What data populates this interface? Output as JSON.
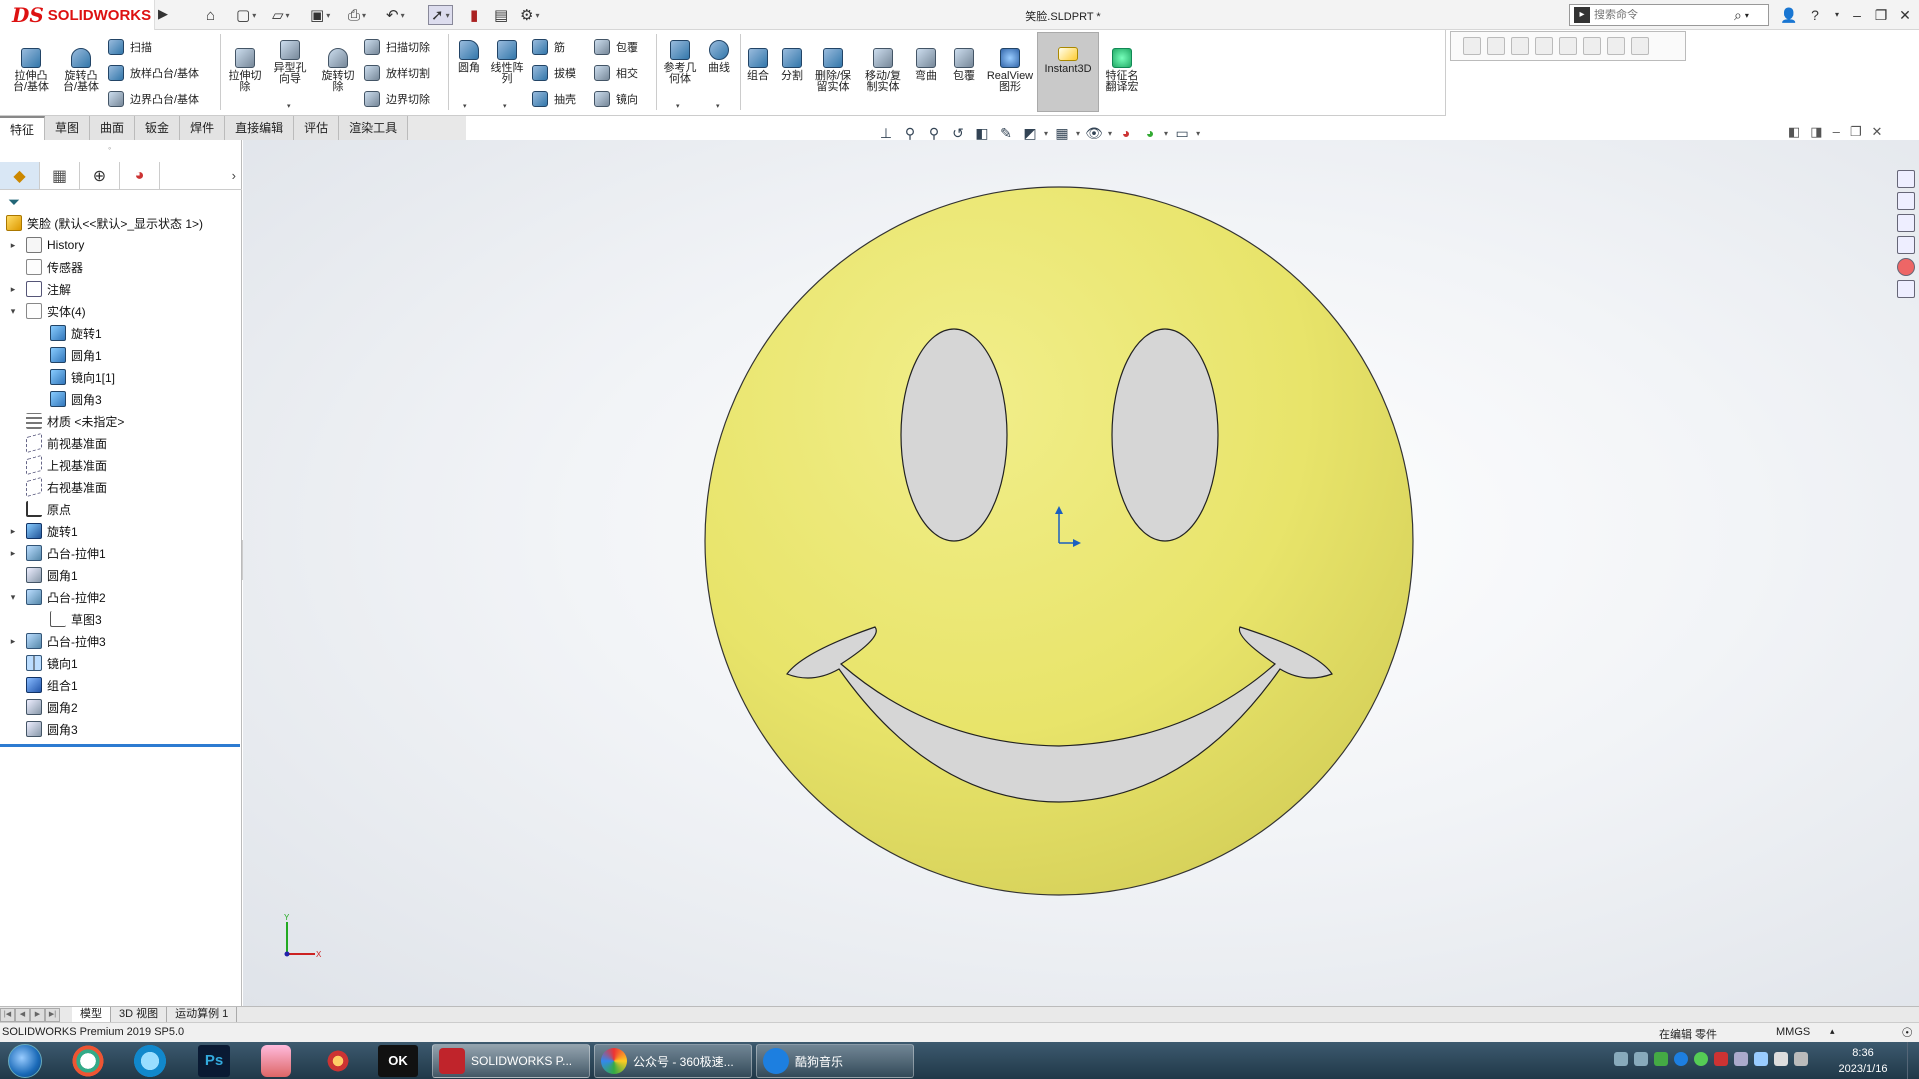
{
  "window": {
    "logo_ds": "DS",
    "logo_text": "SOLIDWORKS",
    "doc_title": "笑脸.SLDPRT *",
    "search_placeholder": "搜索命令",
    "help_label": "?"
  },
  "command_manager": {
    "big_buttons": [
      {
        "id": "extruded-boss",
        "label": "拉伸凸\n台/基体",
        "icon": "extrude-boss-icon"
      },
      {
        "id": "revolved-boss",
        "label": "旋转凸\n台/基体",
        "icon": "revolve-boss-icon"
      },
      {
        "id": "extruded-cut",
        "label": "拉伸切\n除",
        "icon": "extrude-cut-icon"
      },
      {
        "id": "hole-wizard",
        "label": "异型孔\n向导",
        "icon": "hole-wizard-icon"
      },
      {
        "id": "revolved-cut",
        "label": "旋转切\n除",
        "icon": "revolve-cut-icon"
      },
      {
        "id": "fillet",
        "label": "圆角",
        "icon": "fillet-icon"
      },
      {
        "id": "linear-pattern",
        "label": "线性阵\n列",
        "icon": "linear-pattern-icon"
      },
      {
        "id": "reference-geometry",
        "label": "参考几\n何体",
        "icon": "reference-geometry-icon"
      },
      {
        "id": "curves",
        "label": "曲线",
        "icon": "curves-icon"
      },
      {
        "id": "combine",
        "label": "组合",
        "icon": "combine-icon"
      },
      {
        "id": "split",
        "label": "分割",
        "icon": "split-icon"
      },
      {
        "id": "delete-keep-body",
        "label": "删除/保\n留实体",
        "icon": "delete-body-icon"
      },
      {
        "id": "move-copy-body",
        "label": "移动/复\n制实体",
        "icon": "move-copy-icon"
      },
      {
        "id": "flex",
        "label": "弯曲",
        "icon": "flex-icon"
      },
      {
        "id": "wrap",
        "label": "包覆",
        "icon": "wrap-icon"
      },
      {
        "id": "realview",
        "label": "RealView\n图形",
        "icon": "realview-icon"
      },
      {
        "id": "instant3d",
        "label": "Instant3D",
        "icon": "instant3d-icon"
      },
      {
        "id": "feature-translate",
        "label": "特征名\n翻译宏",
        "icon": "macro-icon"
      }
    ],
    "small_buttons": [
      {
        "id": "swept-boss",
        "label": "扫描",
        "icon": "sweep-icon"
      },
      {
        "id": "lofted-boss",
        "label": "放样凸台/基体",
        "icon": "loft-icon"
      },
      {
        "id": "boundary-boss",
        "label": "边界凸台/基体",
        "icon": "boundary-icon"
      },
      {
        "id": "swept-cut",
        "label": "扫描切除",
        "icon": "sweep-cut-icon"
      },
      {
        "id": "lofted-cut",
        "label": "放样切割",
        "icon": "loft-cut-icon"
      },
      {
        "id": "boundary-cut",
        "label": "边界切除",
        "icon": "boundary-cut-icon"
      },
      {
        "id": "rib",
        "label": "筋",
        "icon": "rib-icon"
      },
      {
        "id": "draft",
        "label": "拔模",
        "icon": "draft-icon"
      },
      {
        "id": "shell",
        "label": "抽壳",
        "icon": "shell-icon"
      },
      {
        "id": "wrap-small",
        "label": "包覆",
        "icon": "wrap-small-icon"
      },
      {
        "id": "intersect",
        "label": "相交",
        "icon": "intersect-icon"
      },
      {
        "id": "mirror",
        "label": "镜向",
        "icon": "mirror-icon"
      }
    ]
  },
  "tabs": [
    {
      "label": "特征",
      "active": true
    },
    {
      "label": "草图",
      "active": false
    },
    {
      "label": "曲面",
      "active": false
    },
    {
      "label": "钣金",
      "active": false
    },
    {
      "label": "焊件",
      "active": false
    },
    {
      "label": "直接编辑",
      "active": false
    },
    {
      "label": "评估",
      "active": false
    },
    {
      "label": "渲染工具",
      "active": false
    }
  ],
  "feature_tree": {
    "root": "笑脸 (默认<<默认>_显示状态 1>)",
    "nodes": [
      {
        "label": "History",
        "icon": "history-icon",
        "cls": "ni-hist",
        "indent": 0,
        "expander": "▸"
      },
      {
        "label": "传感器",
        "icon": "sensor-icon",
        "cls": "ni-sens",
        "indent": 0,
        "expander": ""
      },
      {
        "label": "注解",
        "icon": "annotation-icon",
        "cls": "ni-ann",
        "indent": 0,
        "expander": "▸"
      },
      {
        "label": "实体(4)",
        "icon": "solid-bodies-icon",
        "cls": "ni-sens",
        "indent": 0,
        "expander": "▾"
      },
      {
        "label": "旋转1",
        "icon": "body-icon",
        "cls": "ni-body",
        "indent": 1,
        "expander": ""
      },
      {
        "label": "圆角1",
        "icon": "body-icon",
        "cls": "ni-body",
        "indent": 1,
        "expander": ""
      },
      {
        "label": "镜向1[1]",
        "icon": "body-icon",
        "cls": "ni-body",
        "indent": 1,
        "expander": ""
      },
      {
        "label": "圆角3",
        "icon": "body-icon",
        "cls": "ni-body",
        "indent": 1,
        "expander": ""
      },
      {
        "label": "材质 <未指定>",
        "icon": "material-icon",
        "cls": "ni-mat",
        "indent": 0,
        "expander": ""
      },
      {
        "label": "前视基准面",
        "icon": "plane-icon",
        "cls": "ni-plane",
        "indent": 0,
        "expander": ""
      },
      {
        "label": "上视基准面",
        "icon": "plane-icon",
        "cls": "ni-plane",
        "indent": 0,
        "expander": ""
      },
      {
        "label": "右视基准面",
        "icon": "plane-icon",
        "cls": "ni-plane",
        "indent": 0,
        "expander": ""
      },
      {
        "label": "原点",
        "icon": "origin-icon",
        "cls": "ni-orig",
        "indent": 0,
        "expander": ""
      },
      {
        "label": "旋转1",
        "icon": "revolve-feature-icon",
        "cls": "ni-rev",
        "indent": 0,
        "expander": "▸"
      },
      {
        "label": "凸台-拉伸1",
        "icon": "extrude-feature-icon",
        "cls": "ni-ext",
        "indent": 0,
        "expander": "▸"
      },
      {
        "label": "圆角1",
        "icon": "fillet-feature-icon",
        "cls": "ni-fil",
        "indent": 0,
        "expander": ""
      },
      {
        "label": "凸台-拉伸2",
        "icon": "extrude-feature-icon",
        "cls": "ni-ext",
        "indent": 0,
        "expander": "▾"
      },
      {
        "label": "草图3",
        "icon": "sketch-icon",
        "cls": "ni-sk",
        "indent": 1,
        "expander": ""
      },
      {
        "label": "凸台-拉伸3",
        "icon": "extrude-feature-icon",
        "cls": "ni-ext",
        "indent": 0,
        "expander": "▸"
      },
      {
        "label": "镜向1",
        "icon": "mirror-feature-icon",
        "cls": "ni-mir",
        "indent": 0,
        "expander": ""
      },
      {
        "label": "组合1",
        "icon": "combine-feature-icon",
        "cls": "ni-comb",
        "indent": 0,
        "expander": ""
      },
      {
        "label": "圆角2",
        "icon": "fillet-feature-icon",
        "cls": "ni-fil",
        "indent": 0,
        "expander": ""
      },
      {
        "label": "圆角3",
        "icon": "fillet-feature-icon",
        "cls": "ni-fil",
        "indent": 0,
        "expander": ""
      }
    ]
  },
  "triad": {
    "x_label": "X",
    "y_label": "Y"
  },
  "bottom_tabs": [
    {
      "label": "模型",
      "active": true
    },
    {
      "label": "3D 视图",
      "active": false
    },
    {
      "label": "运动算例 1",
      "active": false
    }
  ],
  "status": {
    "app": "SOLIDWORKS Premium 2019 SP5.0",
    "mode": "在编辑 零件",
    "units": "MMGS"
  },
  "taskbar": {
    "tasks": [
      {
        "label": "SOLIDWORKS P...",
        "icon": "solidworks-app-icon",
        "color": "#c0242b"
      },
      {
        "label": "公众号 - 360极速...",
        "icon": "browser-360-icon",
        "color": "#3fa34d"
      },
      {
        "label": "酷狗音乐",
        "icon": "kugou-icon",
        "color": "#1d7fe0"
      }
    ],
    "time": "8:36",
    "date": "2023/1/16"
  },
  "colors": {
    "face": "#e8e46a",
    "face_dark": "#b9b447",
    "cutout": "#d6d6d6",
    "accent": "#2d7bd1"
  }
}
